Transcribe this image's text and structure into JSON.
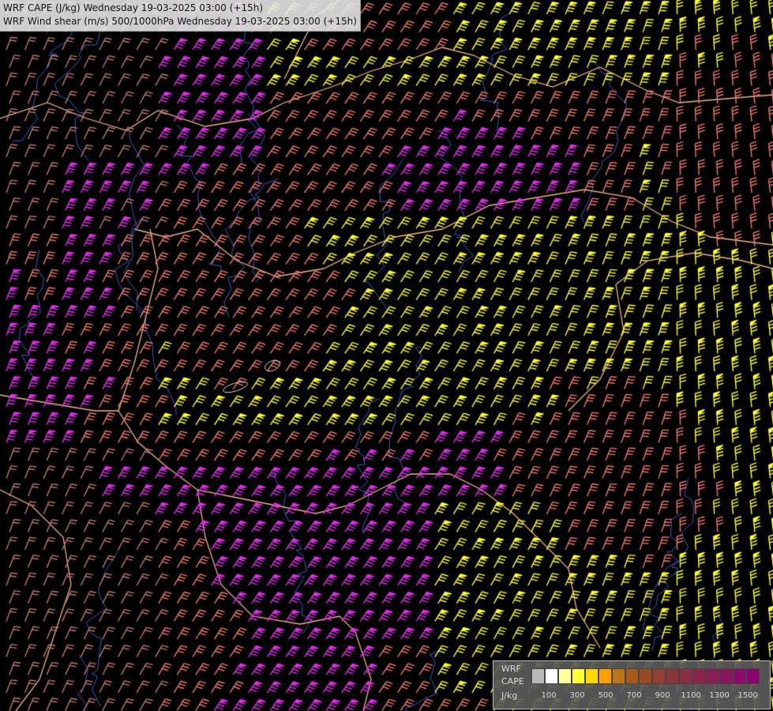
{
  "title": {
    "line1": "WRF CAPE (J/kg) Wednesday 19-03-2025 03:00 (+15h)",
    "line2": "WRF Wind shear (m/s) 500/1000hPa Wednesday 19-03-2025 03:00 (+15h)"
  },
  "legend": {
    "label_model": "WRF",
    "label_field": "CAPE",
    "label_unit": "J/kg",
    "colors": [
      "#b9b9b9",
      "#ffffff",
      "#ffff99",
      "#ffff33",
      "#ffd800",
      "#ff9e00",
      "#b9751c",
      "#a55a1a",
      "#9a4a20",
      "#924030",
      "#8a3638",
      "#8a2c42",
      "#8a244c",
      "#8a1c56",
      "#8a1460",
      "#8a0c6a",
      "#8a046e"
    ],
    "ticks": [
      "100",
      "300",
      "500",
      "700",
      "900",
      "1100",
      "1300",
      "1500"
    ]
  },
  "map": {
    "background": "#000000",
    "border_color": "#f2b48a",
    "river_color": "#3a5fc0",
    "barb_colors": {
      "weak": "#c07a72",
      "moderate": "#f07a72",
      "strong": "#ffff33",
      "very_strong": "#e02ee8"
    }
  }
}
